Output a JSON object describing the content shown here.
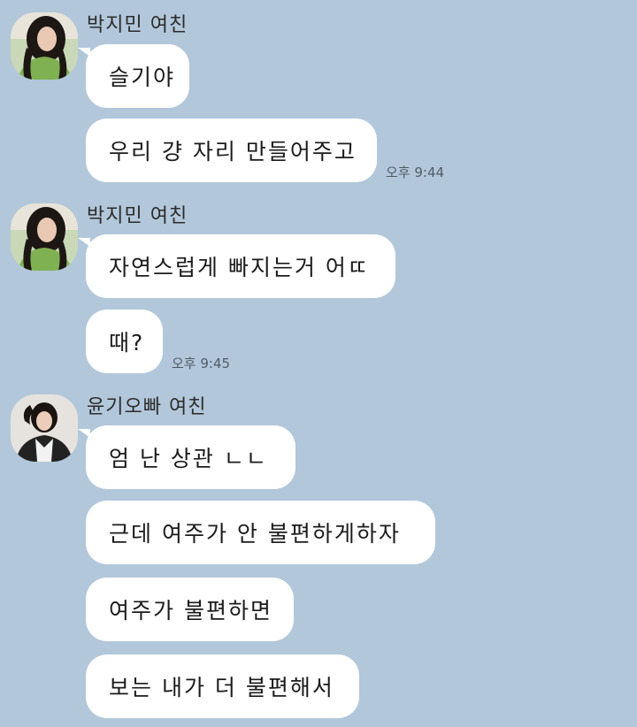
{
  "messages": [
    {
      "sender": "박지민 여친",
      "bubbles": [
        "슬기야",
        "우리 걍 자리 만들어주고"
      ],
      "time": "오후 9:44"
    },
    {
      "sender": "박지민 여친",
      "bubbles": [
        "자연스럽게 빠지는거 어ㄸ",
        "때?"
      ],
      "time": "오후 9:45"
    },
    {
      "sender": "윤기오빠 여친",
      "bubbles": [
        "엄 난 상관 ㄴㄴ",
        "근데 여주가 안 불편하게하자",
        "여주가 불편하면",
        "보는 내가 더 불편해서"
      ]
    }
  ],
  "icons": {
    "avatar_1": "profile-photo-woman-dark-hair-green-top",
    "avatar_2": "profile-photo-woman-dark-hair-green-top",
    "avatar_3": "profile-photo-woman-black-jacket"
  },
  "colors": {
    "background": "#b2c7da",
    "bubble": "#ffffff",
    "text": "#1b1b1b",
    "timestamp": "#4f5b66"
  }
}
